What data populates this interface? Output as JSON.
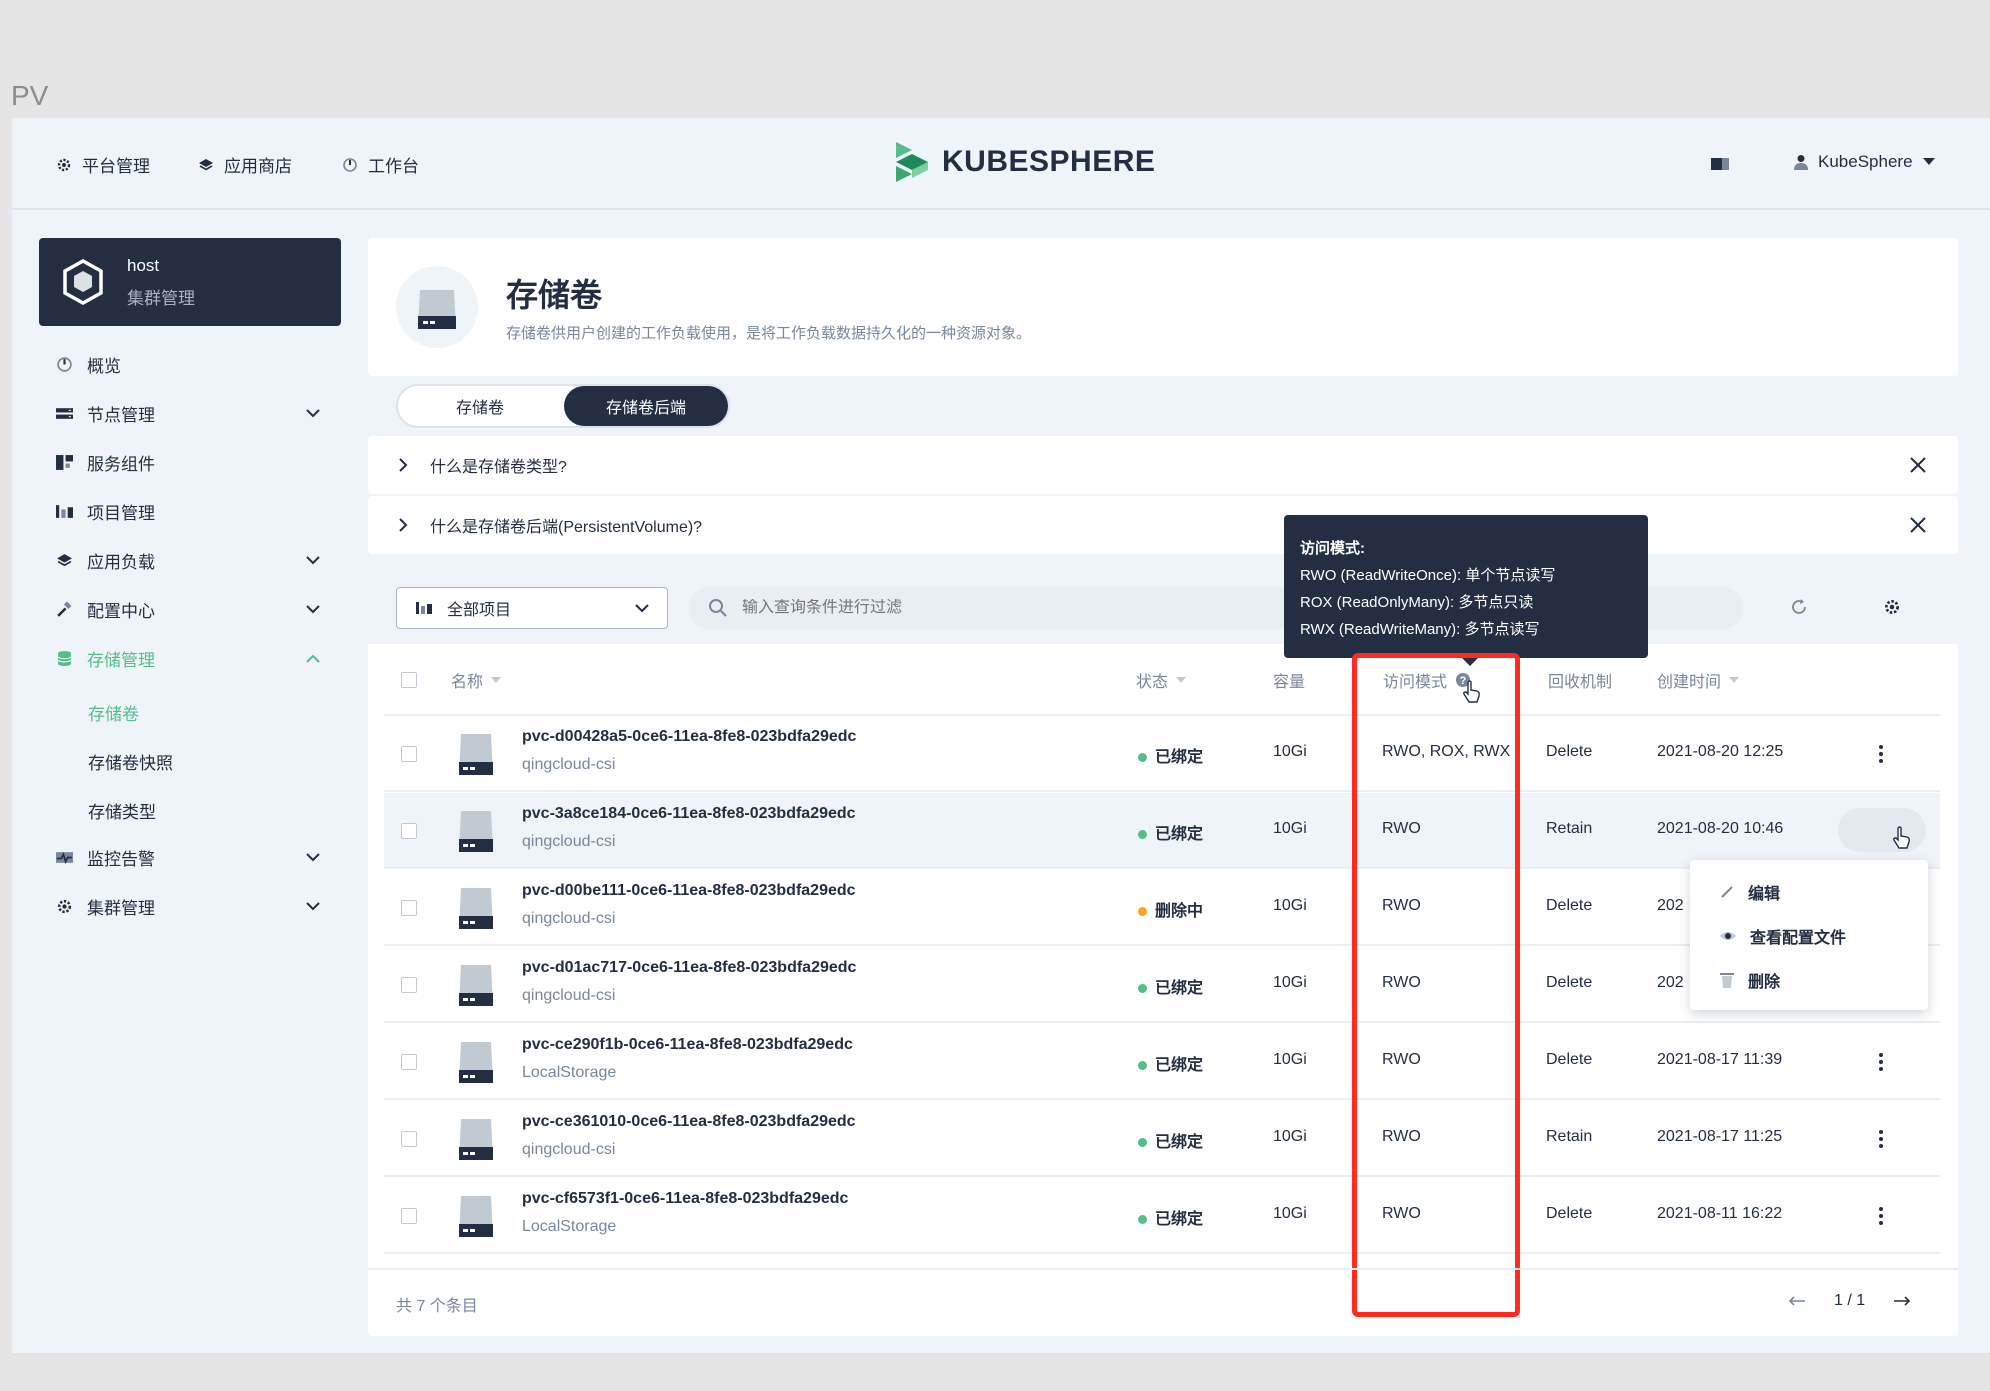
{
  "page_label": "PV",
  "topnav": {
    "platform": "平台管理",
    "appstore": "应用商店",
    "workbench": "工作台",
    "logo": "KUBESPHERE",
    "user": "KubeSphere"
  },
  "cluster": {
    "name": "host",
    "sub": "集群管理"
  },
  "sidebar": {
    "items": [
      {
        "label": "概览"
      },
      {
        "label": "节点管理"
      },
      {
        "label": "服务组件"
      },
      {
        "label": "项目管理"
      },
      {
        "label": "应用负载"
      },
      {
        "label": "配置中心"
      },
      {
        "label": "存储管理"
      },
      {
        "label": "监控告警"
      },
      {
        "label": "集群管理"
      }
    ],
    "storage_sub": [
      "存储卷",
      "存储卷快照",
      "存储类型"
    ]
  },
  "header": {
    "title": "存储卷",
    "desc": "存储卷供用户创建的工作负载使用，是将工作负载数据持久化的一种资源对象。"
  },
  "tabs": [
    "存储卷",
    "存储卷后端"
  ],
  "faq": [
    "什么是存储卷类型?",
    "什么是存储卷后端(PersistentVolume)?"
  ],
  "toolbar": {
    "project_select": "全部项目",
    "search_placeholder": "输入查询条件进行过滤"
  },
  "table": {
    "columns": [
      "名称",
      "状态",
      "容量",
      "访问模式",
      "回收机制",
      "创建时间"
    ],
    "rows": [
      {
        "name": "pvc-d00428a5-0ce6-11ea-8fe8-023bdfa29edc",
        "class": "qingcloud-csi",
        "status": "已绑定",
        "capacity": "10Gi",
        "access": "RWO, ROX, RWX",
        "reclaim": "Delete",
        "created": "2021-08-20 12:25"
      },
      {
        "name": "pvc-3a8ce184-0ce6-11ea-8fe8-023bdfa29edc",
        "class": "qingcloud-csi",
        "status": "已绑定",
        "capacity": "10Gi",
        "access": "RWO",
        "reclaim": "Retain",
        "created": "2021-08-20 10:46"
      },
      {
        "name": "pvc-d00be111-0ce6-11ea-8fe8-023bdfa29edc",
        "class": "qingcloud-csi",
        "status": "删除中",
        "capacity": "10Gi",
        "access": "RWO",
        "reclaim": "Delete",
        "created": "202"
      },
      {
        "name": "pvc-d01ac717-0ce6-11ea-8fe8-023bdfa29edc",
        "class": "qingcloud-csi",
        "status": "已绑定",
        "capacity": "10Gi",
        "access": "RWO",
        "reclaim": "Delete",
        "created": "202"
      },
      {
        "name": "pvc-ce290f1b-0ce6-11ea-8fe8-023bdfa29edc",
        "class": "LocalStorage",
        "status": "已绑定",
        "capacity": "10Gi",
        "access": "RWO",
        "reclaim": "Delete",
        "created": "2021-08-17 11:39"
      },
      {
        "name": "pvc-ce361010-0ce6-11ea-8fe8-023bdfa29edc",
        "class": "qingcloud-csi",
        "status": "已绑定",
        "capacity": "10Gi",
        "access": "RWO",
        "reclaim": "Retain",
        "created": "2021-08-17 11:25"
      },
      {
        "name": "pvc-cf6573f1-0ce6-11ea-8fe8-023bdfa29edc",
        "class": "LocalStorage",
        "status": "已绑定",
        "capacity": "10Gi",
        "access": "RWO",
        "reclaim": "Delete",
        "created": "2021-08-11 16:22"
      }
    ]
  },
  "tooltip": {
    "title": "访问模式:",
    "lines": [
      "RWO (ReadWriteOnce): 单个节点读写",
      "ROX (ReadOnlyMany): 多节点只读",
      "RWX (ReadWriteMany): 多节点读写"
    ]
  },
  "dropdown": [
    "编辑",
    "查看配置文件",
    "删除"
  ],
  "footer": {
    "total": "共 7 个条目",
    "page": "1 / 1"
  },
  "colors": {
    "bound": "#55bc8a",
    "deleting": "#f5a623",
    "highlight_box": "#ff2b1f",
    "dark": "#242e42"
  }
}
